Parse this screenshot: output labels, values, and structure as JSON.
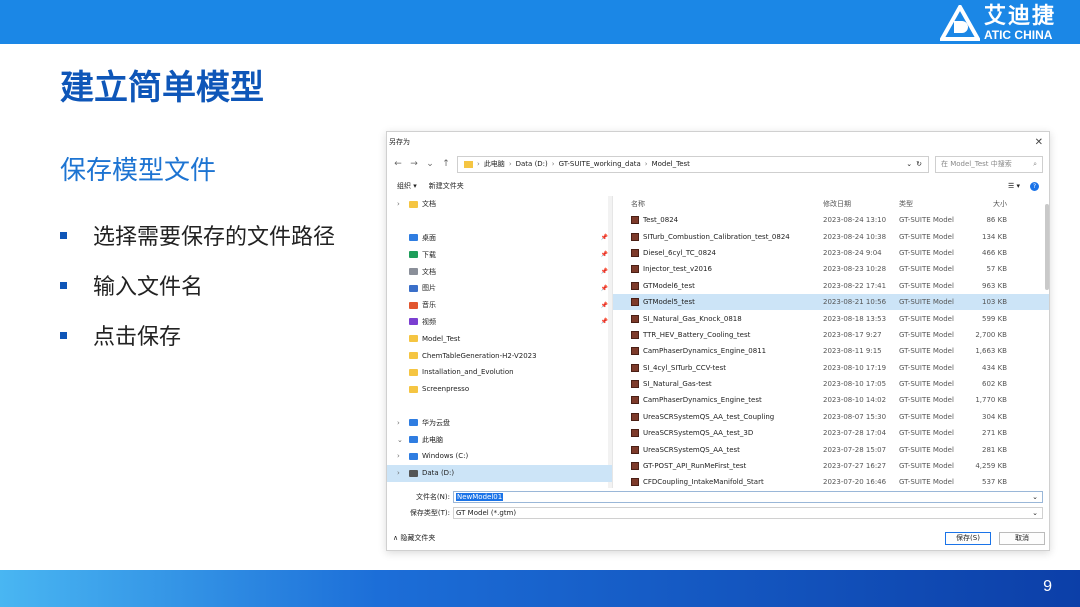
{
  "brand": {
    "name_cn": "艾迪捷",
    "name_en": "ATIC CHINA"
  },
  "slide": {
    "title": "建立简单模型",
    "subtitle": "保存模型文件",
    "bullets": [
      "选择需要保存的文件路径",
      "输入文件名",
      "点击保存"
    ],
    "page_number": "9"
  },
  "dialog": {
    "title": "另存为",
    "breadcrumb": [
      "此电脑",
      "Data (D:)",
      "GT-SUITE_working_data",
      "Model_Test"
    ],
    "search_placeholder": "在 Model_Test 中搜索",
    "toolbar": {
      "organize": "组织 ▾",
      "new_folder": "新建文件夹"
    },
    "nav_items": [
      {
        "label": "文档",
        "chev": "›",
        "color": "#f5c542",
        "pin": ""
      },
      {
        "label": "",
        "chev": "",
        "color": "",
        "pin": ""
      },
      {
        "label": "桌面",
        "chev": "",
        "color": "#2f7de1",
        "pin": "📌"
      },
      {
        "label": "下载",
        "chev": "",
        "color": "#1e9e5a",
        "pin": "📌"
      },
      {
        "label": "文档",
        "chev": "",
        "color": "#8a8f99",
        "pin": "📌"
      },
      {
        "label": "图片",
        "chev": "",
        "color": "#3a6fc9",
        "pin": "📌"
      },
      {
        "label": "音乐",
        "chev": "",
        "color": "#e2562f",
        "pin": "📌"
      },
      {
        "label": "视频",
        "chev": "",
        "color": "#7b3fd1",
        "pin": "📌"
      },
      {
        "label": "Model_Test",
        "chev": "",
        "color": "#f5c542",
        "pin": ""
      },
      {
        "label": "ChemTableGeneration-H2-V2023",
        "chev": "",
        "color": "#f5c542",
        "pin": ""
      },
      {
        "label": "Installation_and_Evolution",
        "chev": "",
        "color": "#f5c542",
        "pin": ""
      },
      {
        "label": "Screenpresso",
        "chev": "",
        "color": "#f5c542",
        "pin": ""
      },
      {
        "label": "",
        "chev": "",
        "color": "",
        "pin": ""
      },
      {
        "label": "华为云盘",
        "chev": "›",
        "color": "#2f7de1",
        "pin": ""
      },
      {
        "label": "此电脑",
        "chev": "⌄",
        "color": "#2f7de1",
        "pin": ""
      },
      {
        "label": "Windows (C:)",
        "chev": "›",
        "color": "#2f7de1",
        "pin": ""
      },
      {
        "label": "Data (D:)",
        "chev": "›",
        "color": "#555555",
        "pin": ""
      }
    ],
    "columns": {
      "name": "名称",
      "date": "修改日期",
      "type": "类型",
      "size": "大小"
    },
    "files": [
      {
        "name": "Test_0824",
        "date": "2023-08-24 13:10",
        "type": "GT-SUITE Model",
        "size": "86 KB"
      },
      {
        "name": "SITurb_Combustion_Calibration_test_0824",
        "date": "2023-08-24 10:38",
        "type": "GT-SUITE Model",
        "size": "134 KB"
      },
      {
        "name": "Diesel_6cyl_TC_0824",
        "date": "2023-08-24 9:04",
        "type": "GT-SUITE Model",
        "size": "466 KB"
      },
      {
        "name": "Injector_test_v2016",
        "date": "2023-08-23 10:28",
        "type": "GT-SUITE Model",
        "size": "57 KB"
      },
      {
        "name": "GTModel6_test",
        "date": "2023-08-22 17:41",
        "type": "GT-SUITE Model",
        "size": "963 KB"
      },
      {
        "name": "GTModel5_test",
        "date": "2023-08-21 10:56",
        "type": "GT-SUITE Model",
        "size": "103 KB"
      },
      {
        "name": "SI_Natural_Gas_Knock_0818",
        "date": "2023-08-18 13:53",
        "type": "GT-SUITE Model",
        "size": "599 KB"
      },
      {
        "name": "TTR_HEV_Battery_Cooling_test",
        "date": "2023-08-17 9:27",
        "type": "GT-SUITE Model",
        "size": "2,700 KB"
      },
      {
        "name": "CamPhaserDynamics_Engine_0811",
        "date": "2023-08-11 9:15",
        "type": "GT-SUITE Model",
        "size": "1,663 KB"
      },
      {
        "name": "SI_4cyl_SITurb_CCV-test",
        "date": "2023-08-10 17:19",
        "type": "GT-SUITE Model",
        "size": "434 KB"
      },
      {
        "name": "SI_Natural_Gas-test",
        "date": "2023-08-10 17:05",
        "type": "GT-SUITE Model",
        "size": "602 KB"
      },
      {
        "name": "CamPhaserDynamics_Engine_test",
        "date": "2023-08-10 14:02",
        "type": "GT-SUITE Model",
        "size": "1,770 KB"
      },
      {
        "name": "UreaSCRSystemQS_AA_test_Coupling",
        "date": "2023-08-07 15:30",
        "type": "GT-SUITE Model",
        "size": "304 KB"
      },
      {
        "name": "UreaSCRSystemQS_AA_test_3D",
        "date": "2023-07-28 17:04",
        "type": "GT-SUITE Model",
        "size": "271 KB"
      },
      {
        "name": "UreaSCRSystemQS_AA_test",
        "date": "2023-07-28 15:07",
        "type": "GT-SUITE Model",
        "size": "281 KB"
      },
      {
        "name": "GT-POST_API_RunMeFirst_test",
        "date": "2023-07-27 16:27",
        "type": "GT-SUITE Model",
        "size": "4,259 KB"
      },
      {
        "name": "CFDCoupling_IntakeManifold_Start",
        "date": "2023-07-20 16:46",
        "type": "GT-SUITE Model",
        "size": "537 KB"
      }
    ],
    "selected_index": 5,
    "filename_label": "文件名(N):",
    "filename_value": "NewModel01",
    "filetype_label": "保存类型(T):",
    "filetype_value": "GT Model (*.gtm)",
    "hide_folders": "∧ 隐藏文件夹",
    "save_label": "保存(S)",
    "cancel_label": "取消"
  }
}
